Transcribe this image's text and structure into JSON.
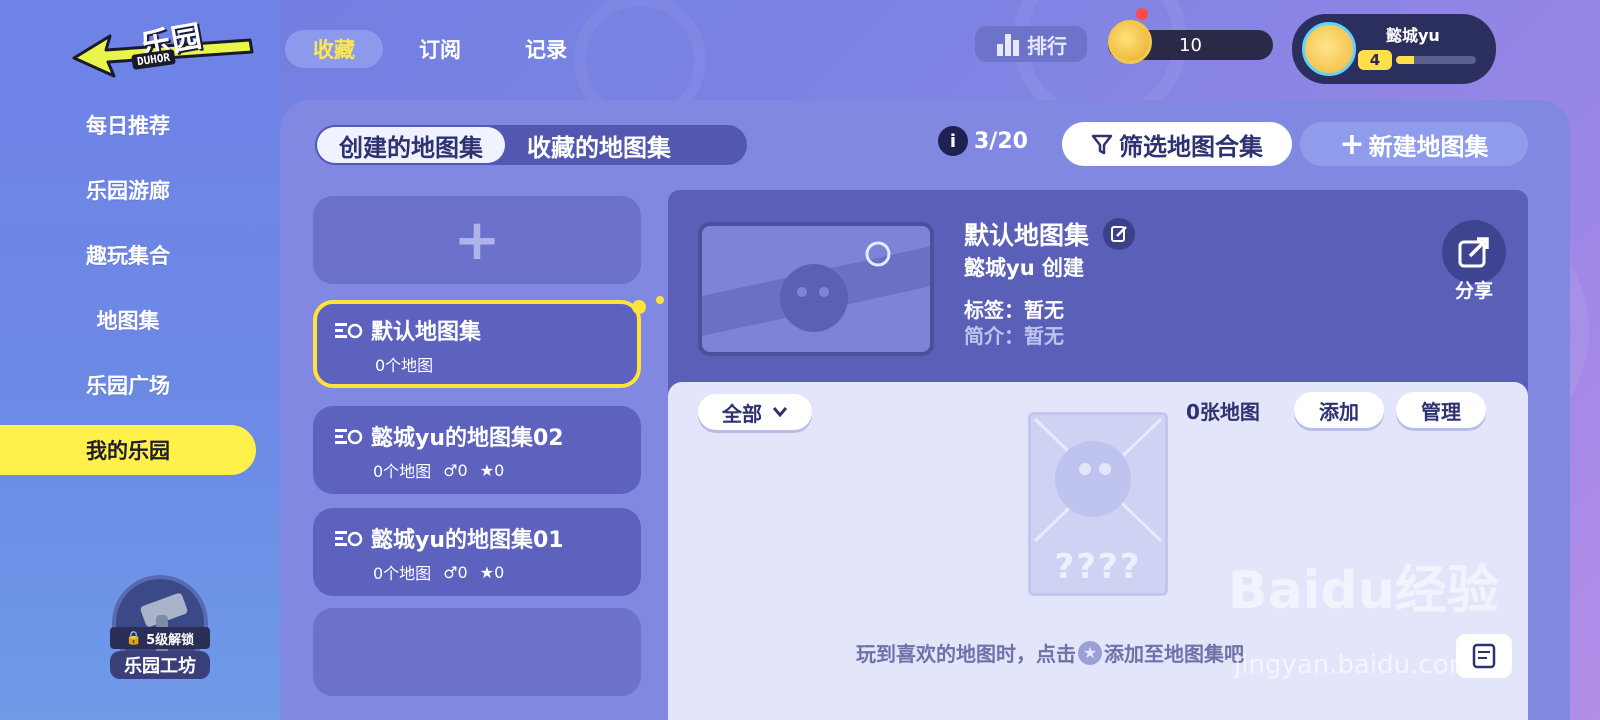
{
  "logo": {
    "title": "乐园",
    "subtitle": "DUHOR"
  },
  "nav": {
    "items": [
      {
        "label": "每日推荐"
      },
      {
        "label": "乐园游廊"
      },
      {
        "label": "趣玩集合"
      },
      {
        "label": "地图集"
      },
      {
        "label": "乐园广场"
      },
      {
        "label": "我的乐园",
        "active": true
      }
    ]
  },
  "workshop": {
    "lock_label": "5级解锁",
    "label": "乐园工坊"
  },
  "top_tabs": [
    {
      "label": "收藏",
      "active": true
    },
    {
      "label": "订阅"
    },
    {
      "label": "记录"
    }
  ],
  "rank": {
    "label": "排行"
  },
  "coins": {
    "value": "10"
  },
  "user": {
    "name": "懿城yu",
    "level": "4",
    "xp_fraction": 0.22
  },
  "sub_tabs": [
    {
      "label": "创建的地图集",
      "active": true
    },
    {
      "label": "收藏的地图集"
    }
  ],
  "count_info": {
    "text": "3/20"
  },
  "filter_button": {
    "label": "筛选地图合集"
  },
  "new_button": {
    "label": "新建地图集"
  },
  "collections": [
    {
      "title": "默认地图集",
      "maps": "0个地图",
      "selected": true
    },
    {
      "title": "懿城yu的地图集02",
      "maps": "0个地图",
      "plays": "0",
      "stars": "0"
    },
    {
      "title": "懿城yu的地图集01",
      "maps": "0个地图",
      "plays": "0",
      "stars": "0"
    }
  ],
  "detail": {
    "title": "默认地图集",
    "creator": "懿城yu 创建",
    "tag": "标签：暂无",
    "intro": "简介：暂无",
    "share_label": "分享",
    "filter_value": "全部",
    "map_count": "0张地图",
    "add_label": "添加",
    "manage_label": "管理",
    "placeholder_text": "????",
    "hint_before": "玩到喜欢的地图时，点击",
    "hint_after": "添加至地图集吧"
  },
  "watermark": {
    "text": "Baidu经验",
    "url": "jingyan.baidu.com"
  },
  "colors": {
    "accent_yellow": "#ffe23a",
    "panel": "#5a5fb8",
    "body_light": "#e3e6fb",
    "text_dark": "#2e3270"
  }
}
